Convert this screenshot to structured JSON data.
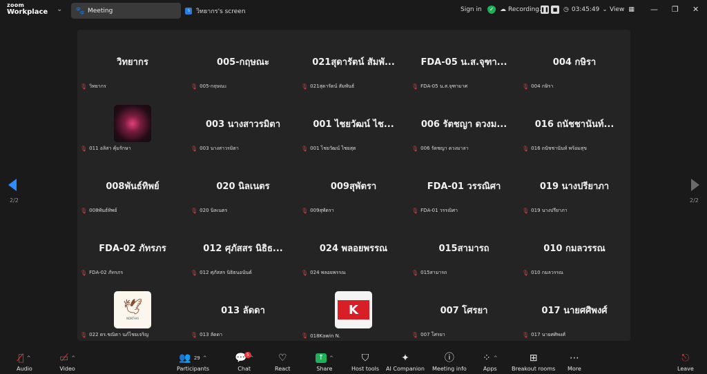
{
  "topbar": {
    "brand_small": "zoom",
    "brand_big": "Workplace",
    "tab_meeting": "Meeting",
    "tab_screen": "วิทยากร's screen",
    "tab_screen_badge": "ว",
    "signin": "Sign in",
    "recording": "Recording...",
    "timer": "03:45:49",
    "view": "View"
  },
  "gallery": {
    "page_indicator_left": "2/2",
    "page_indicator_right": "2/2",
    "tiles": [
      {
        "big": "วิทยากร",
        "name": "วิทยากร"
      },
      {
        "big": "005-กฤษณะ",
        "name": "005-กฤษณะ"
      },
      {
        "big": "021สุดารัตน์ สัมพั...",
        "name": "021สุดารัตน์ สัมพันธ์"
      },
      {
        "big": "FDA-05 น.ส.จุฑา...",
        "name": "FDA-05 น.ส.จุฑามาศ"
      },
      {
        "big": "004 กษิรา",
        "name": "004 กษิรา"
      },
      {
        "big": "",
        "name": "011 อลิสา คุ้มรักษา",
        "avatar": "rose"
      },
      {
        "big": "003 นางสาวรมิตา",
        "name": "003 นางสาวรมิตา"
      },
      {
        "big": "001 ไชยวัฒน์ ไช...",
        "name": "001 ไชยวัฒน์ ไชยสุต"
      },
      {
        "big": "006 รัตชญา ดวงม...",
        "name": "006 รัตชญา ดวงมาลา"
      },
      {
        "big": "016 ถนัชชานันท์...",
        "name": "016 ถนัชชานันท์ พร้อมสุข"
      },
      {
        "big": "008พันธ์ทิพย์",
        "name": "008พันธ์ทิพย์"
      },
      {
        "big": "020 นิลเนตร",
        "name": "020 นิลเนตร"
      },
      {
        "big": "009สุพัตรา",
        "name": "009สุพัตรา"
      },
      {
        "big": "FDA-01 วรรณิศา",
        "name": "FDA-01 วรรณิศา"
      },
      {
        "big": "019 นางปรียาภา",
        "name": "019 นางปรียาภา"
      },
      {
        "big": "FDA-02 ภัทรภร",
        "name": "FDA-02 ภัทรภร"
      },
      {
        "big": "012 ศุภัสสร นิธิธ...",
        "name": "012 ศุภัสสร นิธิธนอนันต์"
      },
      {
        "big": "024 พลอยพรรณ",
        "name": "024 พลอยพรรณ"
      },
      {
        "big": "015สามารถ",
        "name": "015สามารถ"
      },
      {
        "big": "010 กมลวรรณ",
        "name": "010 กมลวรรณ"
      },
      {
        "big": "",
        "name": "022 ดร.ชณิตา นภ์ไชยเจริญ",
        "avatar": "bird",
        "avatar_text": "NOKTHAI"
      },
      {
        "big": "013 ลัดดา",
        "name": "013 ลัดดา"
      },
      {
        "big": "",
        "name": "018Kawin N.",
        "avatar": "k",
        "avatar_text": "K"
      },
      {
        "big": "007 โศรยา",
        "name": "007 โศรยา"
      },
      {
        "big": "017 นายศศิพงศ์",
        "name": "017 นายศศิพงศ์"
      }
    ]
  },
  "toolbar": {
    "audio": "Audio",
    "video": "Video",
    "participants": "Participants",
    "participants_count": "29",
    "chat": "Chat",
    "chat_badge": "5",
    "react": "React",
    "share": "Share",
    "host_tools": "Host tools",
    "ai_companion": "AI Companion",
    "meeting_info": "Meeting info",
    "apps": "Apps",
    "breakout_rooms": "Breakout rooms",
    "more": "More",
    "leave": "Leave"
  },
  "colors": {
    "background": "#1a1a1a",
    "gallery_bg": "#242424",
    "muted_red": "#e0383e",
    "accent_blue": "#2d8cff",
    "secure_green": "#1fb05a"
  }
}
